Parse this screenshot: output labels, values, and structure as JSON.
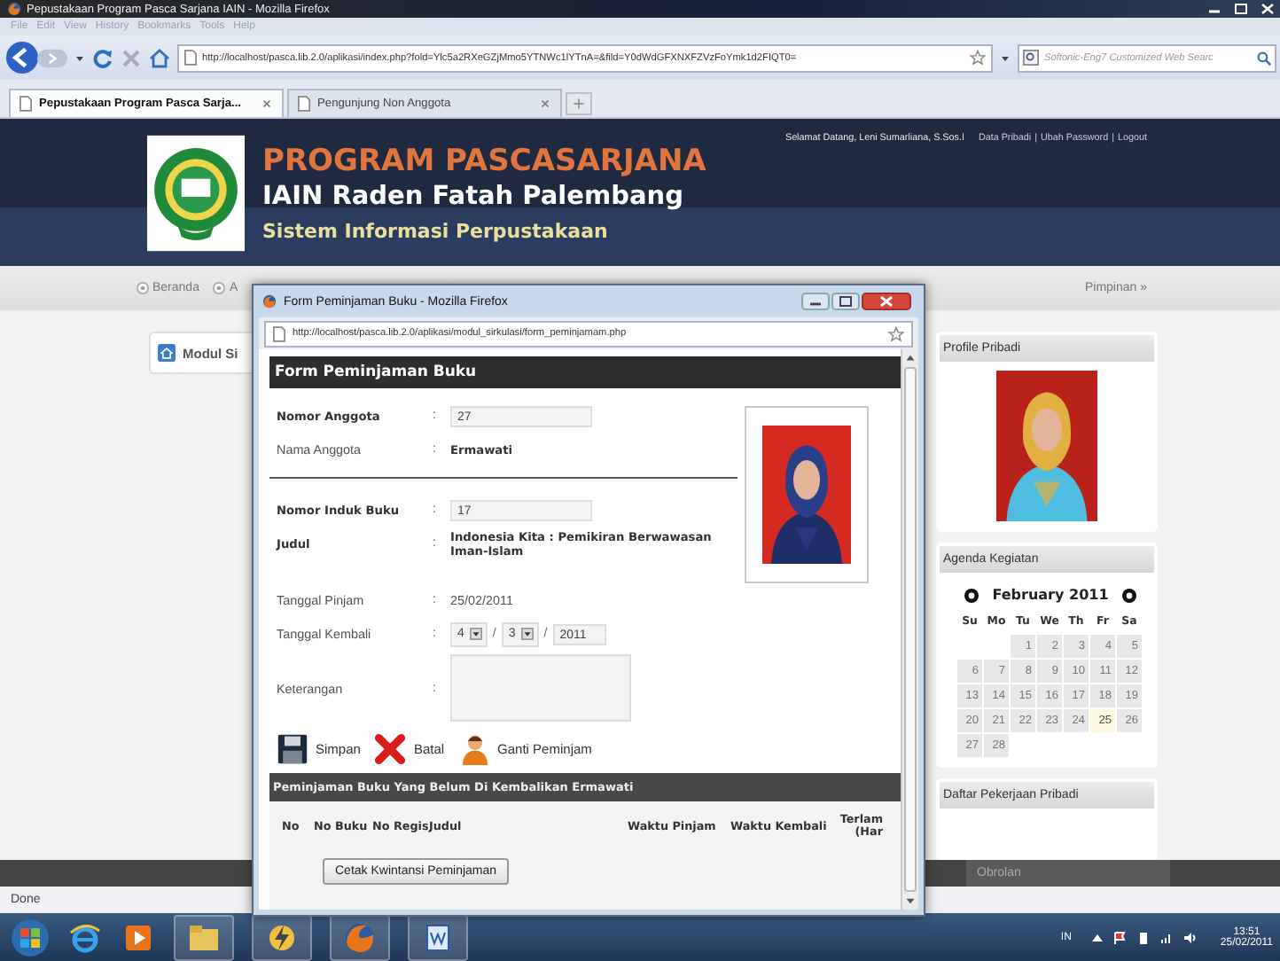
{
  "browser": {
    "title": "Pepustakaan Program Pasca Sarjana IAIN - Mozilla Firefox",
    "menu": [
      "File",
      "Edit",
      "View",
      "History",
      "Bookmarks",
      "Tools",
      "Help"
    ],
    "url": "http://localhost/pasca.lib.2.0/aplikasi/index.php?fold=Ylc5a2RXeGZjMmo5YTNWc1lYTnA=&fild=Y0dWdGFXNXFZVzFoYmk1d2FIQT0=",
    "search_placeholder": "Softonic-Eng7 Customized Web Searc",
    "tabs": [
      {
        "label": "Pepustakaan Program Pasca Sarja...",
        "selected": true
      },
      {
        "label": "Pengunjung Non Anggota",
        "selected": false
      }
    ],
    "status": "Done"
  },
  "header": {
    "title": "PROGRAM PASCASARJANA",
    "subtitle": "IAIN Raden Fatah Palembang",
    "system": "Sistem Informasi Perpustakaan",
    "greeting": "Selamat Datang, Leni Sumarliana, S.Sos.I",
    "links": [
      {
        "label": "Data Pribadi"
      },
      {
        "separator": "|",
        "label": "Ubah Password"
      },
      {
        "separator": "|",
        "label": "Logout"
      }
    ]
  },
  "nav": {
    "left": [
      "Beranda",
      "A"
    ],
    "right": [
      "Pimpinan »"
    ]
  },
  "main": {
    "module_title": "Modul Si"
  },
  "sidebar": {
    "profile_title": "Profile Pribadi",
    "agenda_title": "Agenda Kegiatan",
    "tasks_title": "Daftar Pekerjaan Pribadi",
    "calendar": {
      "month": "February 2011",
      "weekdays": [
        "Su",
        "Mo",
        "Tu",
        "We",
        "Th",
        "Fr",
        "Sa"
      ],
      "days": [
        {
          "label": "1",
          "today": false
        },
        {
          "label": "2",
          "today": false
        },
        {
          "label": "3",
          "today": false
        },
        {
          "label": "4",
          "today": false
        },
        {
          "label": "5",
          "today": false
        },
        {
          "label": "6",
          "today": false
        },
        {
          "label": "7",
          "today": false
        },
        {
          "label": "8",
          "today": false
        },
        {
          "label": "9",
          "today": false
        },
        {
          "label": "10",
          "today": false
        },
        {
          "label": "11",
          "today": false
        },
        {
          "label": "12",
          "today": false
        },
        {
          "label": "13",
          "today": false
        },
        {
          "label": "14",
          "today": false
        },
        {
          "label": "15",
          "today": false
        },
        {
          "label": "16",
          "today": false
        },
        {
          "label": "17",
          "today": false
        },
        {
          "label": "18",
          "today": false
        },
        {
          "label": "19",
          "today": false
        },
        {
          "label": "20",
          "today": false
        },
        {
          "label": "21",
          "today": false
        },
        {
          "label": "22",
          "today": false
        },
        {
          "label": "23",
          "today": false
        },
        {
          "label": "24",
          "today": false
        },
        {
          "label": "25",
          "today": true
        },
        {
          "label": "26",
          "today": false
        },
        {
          "label": "27",
          "today": false
        },
        {
          "label": "28",
          "today": false
        }
      ]
    }
  },
  "footer": {
    "chat": "Obrolan"
  },
  "taskbar": {
    "language": "IN",
    "time": "13:51",
    "date": "25/02/2011"
  },
  "popup": {
    "title": "Form Peminjaman Buku - Mozilla Firefox",
    "url": "http://localhost/pasca.lib.2.0/aplikasi/modul_sirkulasi/form_peminjamam.php",
    "form_title": "Form Peminjaman Buku",
    "member_fields": [
      {
        "kind": "input",
        "label": "Nomor Anggota",
        "label_bold": true,
        "colon": ":",
        "value": "27"
      },
      {
        "kind": "text",
        "label": "Nama Anggota",
        "label_bold": false,
        "colon": ":",
        "value": "Ermawati",
        "value_bold": true
      }
    ],
    "book_fields": [
      {
        "kind": "input",
        "label": "Nomor Induk Buku",
        "label_bold": true,
        "colon": ":",
        "value": "17"
      },
      {
        "kind": "text",
        "label": "Judul",
        "label_bold": true,
        "colon": ":",
        "value": "Indonesia Kita : Pemikiran Berwawasan Iman-Islam",
        "value_bold": true
      }
    ],
    "loan_fields": [
      {
        "kind": "text",
        "label": "Tanggal Pinjam",
        "label_bold": false,
        "colon": ":",
        "value": "25/02/2011",
        "value_bold": false
      },
      {
        "kind": "date",
        "label": "Tanggal Kembali",
        "label_bold": false,
        "colon": ":",
        "parts": [
          {
            "kind": "select",
            "value": "4"
          },
          {
            "kind": "sep",
            "value": "/"
          },
          {
            "kind": "select",
            "value": "3"
          },
          {
            "kind": "sep",
            "value": "/"
          },
          {
            "kind": "input",
            "value": "2011"
          }
        ]
      },
      {
        "kind": "textarea",
        "label": "Keterangan",
        "label_bold": false,
        "colon": ":"
      }
    ],
    "actions": [
      {
        "kind": "save",
        "label": "Simpan"
      },
      {
        "kind": "cancel",
        "label": "Batal"
      },
      {
        "kind": "person",
        "label": "Ganti Peminjam"
      }
    ],
    "section_title": "Peminjaman Buku Yang Belum Di Kembalikan Ermawati",
    "columns": [
      "No",
      "No Buku",
      "No Regis",
      "Judul",
      "Waktu Pinjam",
      "Waktu Kembali",
      "Terlam (Har"
    ],
    "print_button": "Cetak Kwintansi Peminjaman"
  }
}
